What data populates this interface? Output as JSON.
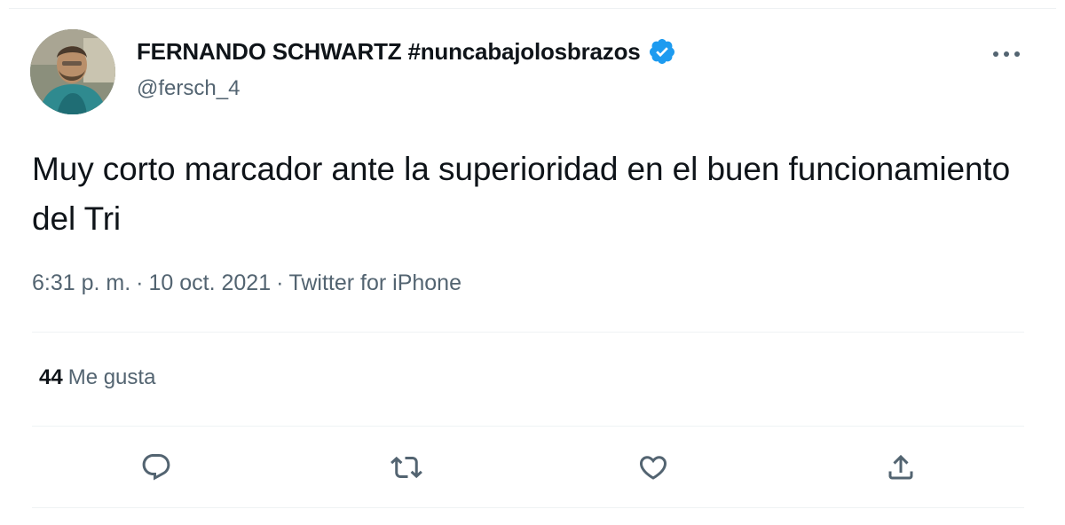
{
  "author": {
    "display_name": "FERNANDO SCHWARTZ #nuncabajolosbrazos",
    "handle": "@fersch_4",
    "verified": true
  },
  "tweet": {
    "text": "Muy corto marcador ante la superioridad en el buen funcionamiento del Tri",
    "time": "6:31 p. m.",
    "date": "10 oct. 2021",
    "separator": "·",
    "source": "Twitter for iPhone"
  },
  "stats": {
    "likes_count": "44",
    "likes_label": "Me gusta"
  },
  "icons": {
    "more": "more-horizontal-icon",
    "reply": "reply-icon",
    "retweet": "retweet-icon",
    "like": "heart-icon",
    "share": "share-icon",
    "verified": "verified-badge-icon"
  },
  "colors": {
    "verified_blue": "#1d9bf0",
    "secondary_text": "#536471",
    "primary_text": "#0f1419"
  }
}
